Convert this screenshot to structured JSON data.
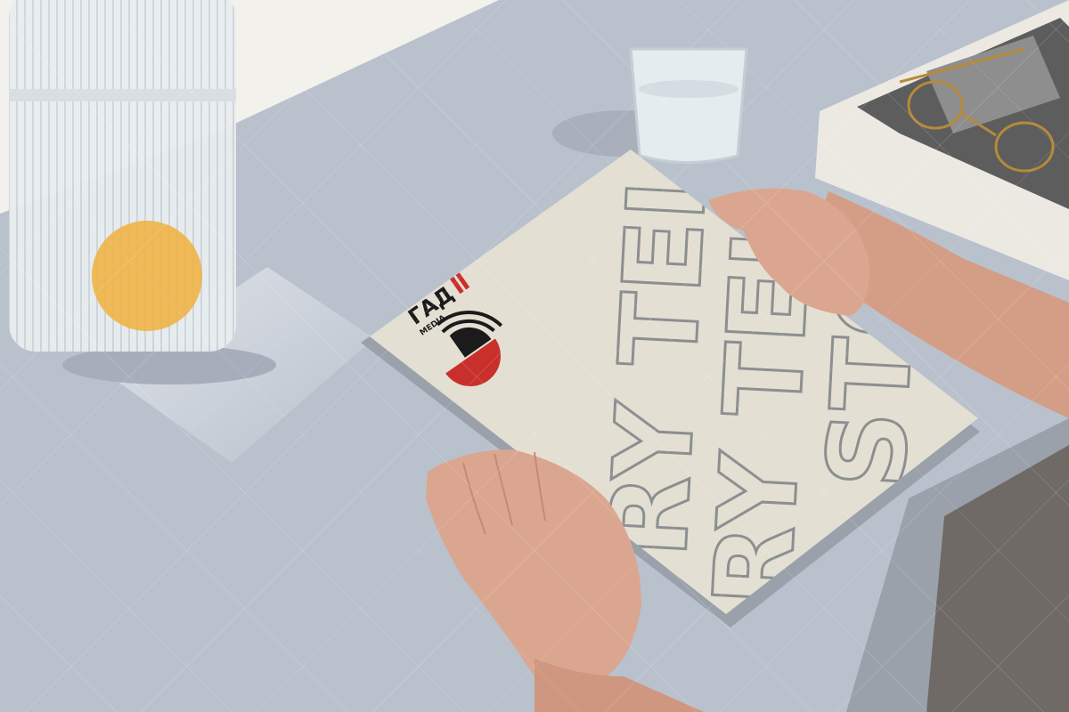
{
  "scene": {
    "colors": {
      "table": "#b9c1cd",
      "booklet": "#e4dfd3",
      "outline_text": "#8c8f91",
      "brand_red": "#c9302c",
      "brand_black": "#1b1b1b",
      "skin": "#d9a48c",
      "vase": "#e6ebee",
      "fruit": "#f0b03c"
    },
    "booklet": {
      "logo_text": "ГАД",
      "logo_subtext": "MEDIA",
      "big_text_row1": "RY TELLER",
      "big_text_row2": "RY TELLER",
      "big_text_row3": "STO"
    }
  }
}
